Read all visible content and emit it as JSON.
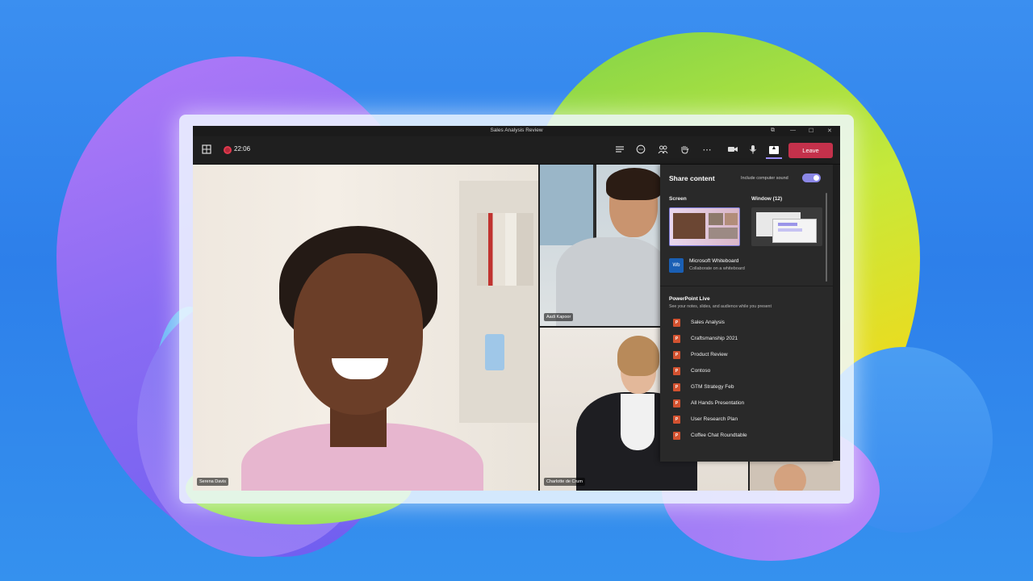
{
  "window": {
    "title": "Sales Analysis Review",
    "controls": [
      "⧉",
      "—",
      "☐",
      "✕"
    ]
  },
  "toolbar": {
    "timer": "22:06",
    "leave_label": "Leave",
    "icons": {
      "grid": "grid-icon",
      "chat_list": "list-icon",
      "chat": "chat-icon",
      "people": "people-icon",
      "react": "raise-hand-icon",
      "more": "more-icon",
      "camera": "camera-icon",
      "mic": "mic-icon",
      "share": "share-icon"
    }
  },
  "participants": [
    {
      "name": "Serena Davis"
    },
    {
      "name": "Aadi Kapoor"
    },
    {
      "name": "Charlotte de Crum"
    }
  ],
  "share_panel": {
    "title": "Share content",
    "sound_label": "Include computer sound",
    "sound_on": true,
    "screen_label": "Screen",
    "window_label": "Window (12)",
    "whiteboard": {
      "title": "Microsoft Whiteboard",
      "subtitle": "Collaborate on a whiteboard",
      "icon_text": "Wb"
    },
    "powerpoint": {
      "title": "PowerPoint Live",
      "subtitle": "See your notes, slides, and audience while you present",
      "files": [
        "Sales Analysis",
        "Craftsmanship 2021",
        "Product Review",
        "Contoso",
        "GTM Strategy Feb",
        "All Hands Presentation",
        "User Research Plan",
        "Coffee Chat Roundtable"
      ],
      "file_icon_text": "P"
    }
  },
  "colors": {
    "leave": "#c4314b",
    "accent": "#8b87e6",
    "ppt": "#d35230"
  }
}
